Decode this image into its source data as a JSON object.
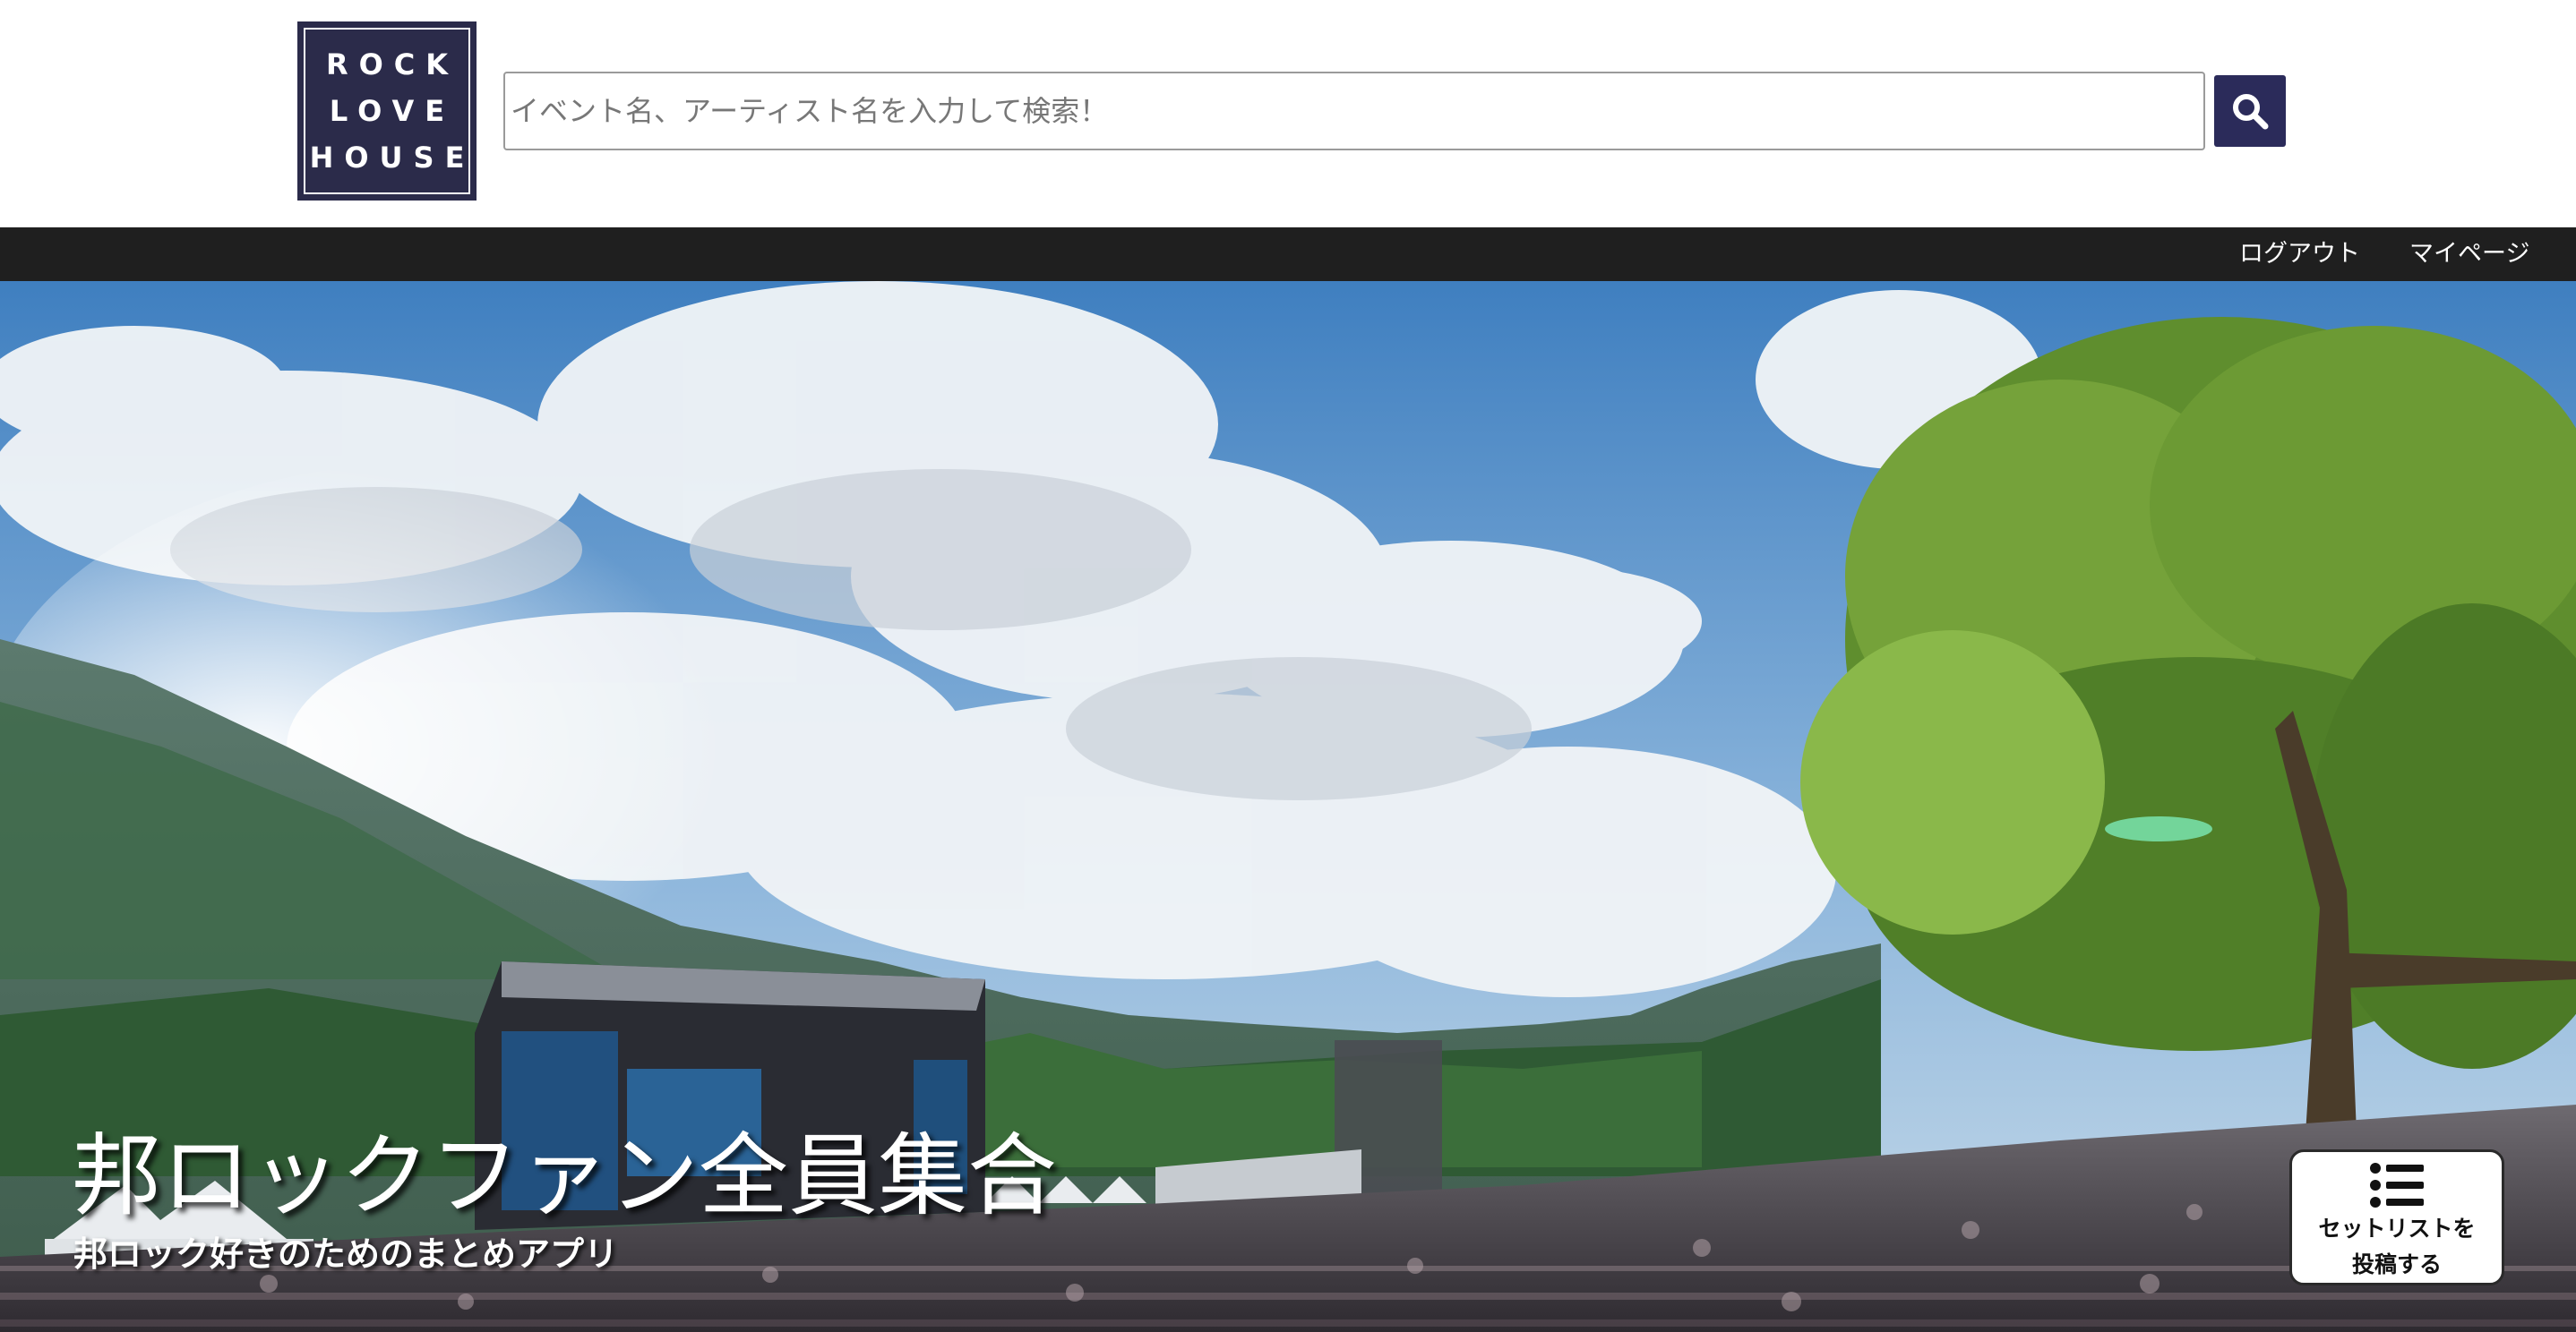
{
  "header": {
    "logo": {
      "lines": [
        "ROCK",
        "LOVE",
        "HOUSE"
      ]
    },
    "search": {
      "placeholder": "イベント名、アーティスト名を入力して検索！",
      "value": "",
      "button_icon": "search-icon"
    }
  },
  "nav": {
    "logout_label": "ログアウト",
    "mypage_label": "マイページ"
  },
  "hero": {
    "title": "邦ロックファン全員集合",
    "subtitle": "邦ロック好きのためのまとめアプリ"
  },
  "floating_action": {
    "icon": "list-icon",
    "label_line1": "セットリストを",
    "label_line2": "投稿する"
  },
  "colors": {
    "brand_navy": "#2b2b4a",
    "search_button": "#2b2b5a",
    "navbar_bg": "#1f1f1f"
  }
}
